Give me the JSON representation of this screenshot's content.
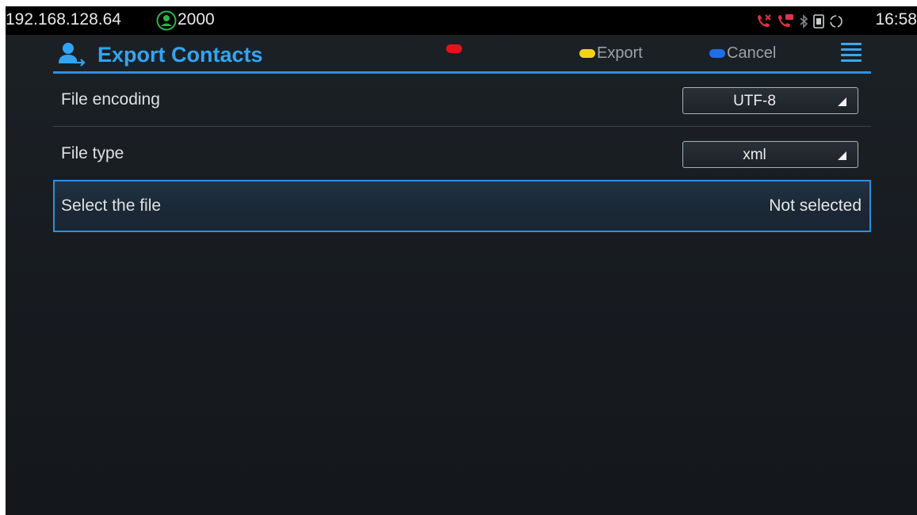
{
  "status": {
    "ip": "192.168.128.64",
    "extension": "2000",
    "time": "16:58",
    "icons": [
      "missed-call-icon",
      "voicemail-call-icon",
      "bluetooth-icon",
      "sim-icon",
      "sync-icon"
    ]
  },
  "header": {
    "title": "Export Contacts",
    "softkeys": [
      {
        "label": "",
        "color": "#e8101a"
      },
      {
        "label": "Export",
        "color": "#f3d21c"
      },
      {
        "label": "Cancel",
        "color": "#1f6ee8"
      }
    ]
  },
  "rows": [
    {
      "label": "File encoding",
      "value": "UTF-8"
    },
    {
      "label": "File type",
      "value": "xml"
    },
    {
      "label": "Select the file",
      "value": "Not selected"
    }
  ],
  "colors": {
    "accent": "#31a5f5",
    "selection_border": "#2a8fe8"
  }
}
